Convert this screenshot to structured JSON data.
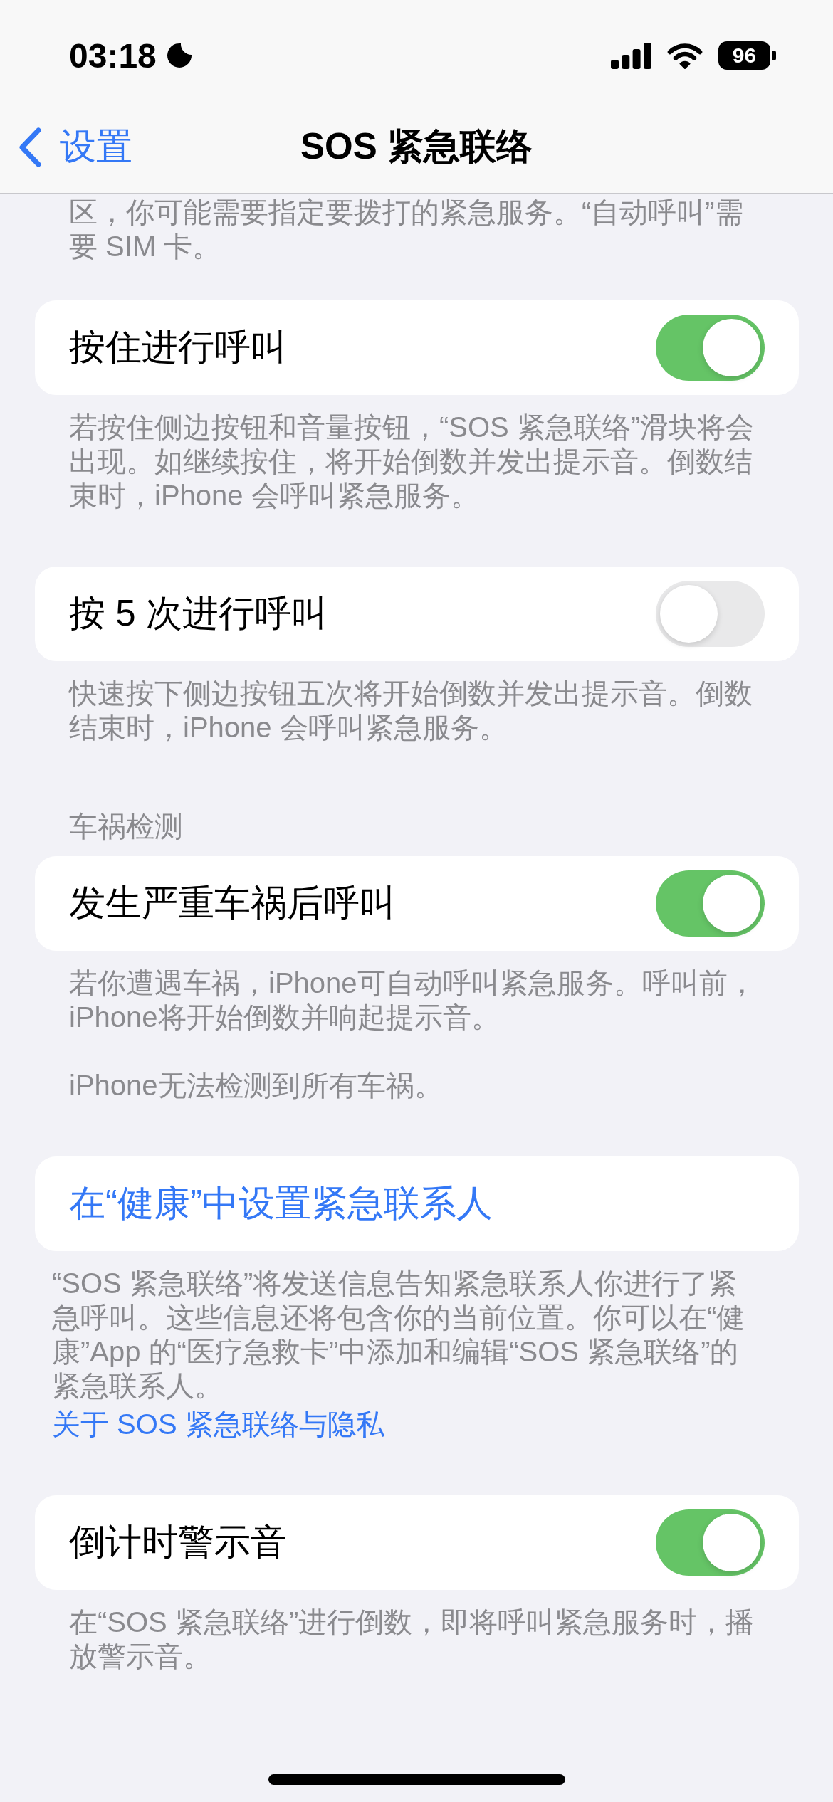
{
  "status_bar": {
    "time": "03:18",
    "battery": "96"
  },
  "nav_bar": {
    "back_label": "设置",
    "title": "SOS 紧急联络"
  },
  "intro_text": "区，你可能需要指定要拨打的紧急服务。“自动呼叫”需要 SIM 卡。",
  "sections": [
    {
      "kind": "toggle",
      "label": "按住进行呼叫",
      "on": true,
      "footer": [
        "若按住侧边按钮和音量按钮，“SOS 紧急联络”滑块将会出现。如继续按住，将开始倒数并发出提示音。倒数结束时，iPhone 会呼叫紧急服务。"
      ]
    },
    {
      "kind": "toggle",
      "label": "按 5 次进行呼叫",
      "on": false,
      "footer": [
        "快速按下侧边按钮五次将开始倒数并发出提示音。倒数结束时，iPhone 会呼叫紧急服务。"
      ]
    },
    {
      "kind": "toggle",
      "header": "车祸检测",
      "label": "发生严重车祸后呼叫",
      "on": true,
      "footer": [
        "若你遭遇车祸，iPhone可自动呼叫紧急服务。呼叫前，iPhone将开始倒数并响起提示音。",
        "iPhone无法检测到所有车祸。"
      ]
    },
    {
      "kind": "link",
      "label": "在“健康”中设置紧急联系人",
      "footer": [
        "“SOS 紧急联络”将发送信息告知紧急联系人你进行了紧急呼叫。这些信息还将包含你的当前位置。你可以在“健康”App 的“医疗急救卡”中添加和编辑“SOS 紧急联络”的紧急联系人。"
      ],
      "footer_link": "关于 SOS 紧急联络与隐私"
    },
    {
      "kind": "toggle",
      "label": "倒计时警示音",
      "on": true,
      "footer": [
        "在“SOS 紧急联络”进行倒数，即将呼叫紧急服务时，播放警示音。"
      ]
    }
  ]
}
